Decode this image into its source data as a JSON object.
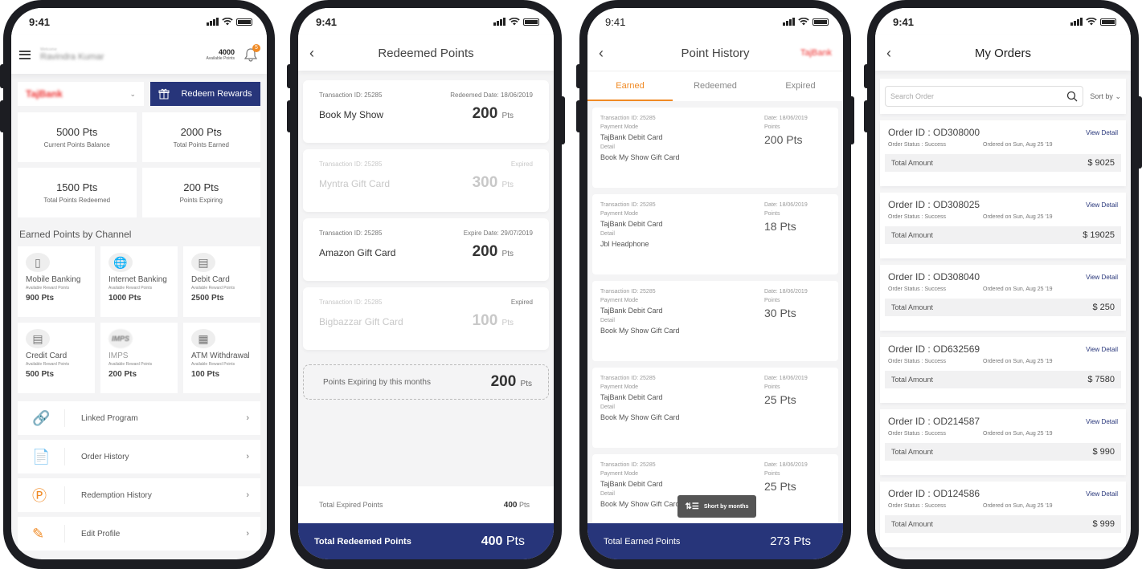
{
  "status_time": "9:41",
  "screen1": {
    "user_small": "Welcome",
    "user_name": "Ravindra Kumar",
    "available_points": "4000",
    "available_points_label": "Available Points",
    "notification_count": "5",
    "bank_name": "TajBank",
    "redeem_button": "Redeem Rewards",
    "stats": [
      {
        "value": "5000 Pts",
        "label": "Current Points Balance"
      },
      {
        "value": "2000 Pts",
        "label": "Total Points Earned"
      },
      {
        "value": "1500 Pts",
        "label": "Total Points Redeemed"
      },
      {
        "value": "200 Pts",
        "label": "Points Expiring"
      }
    ],
    "channels_title": "Earned Points by Channel",
    "channels": [
      {
        "name": "Mobile Banking",
        "sub": "Available Reward Points",
        "points": "900 Pts"
      },
      {
        "name": "Internet Banking",
        "sub": "Available Reward Points",
        "points": "1000 Pts"
      },
      {
        "name": "Debit Card",
        "sub": "Available Reward Points",
        "points": "2500 Pts"
      },
      {
        "name": "Credit Card",
        "sub": "Available Reward Points",
        "points": "500 Pts"
      },
      {
        "name": "IMPS",
        "sub": "Available Reward Points",
        "points": "200 Pts"
      },
      {
        "name": "ATM Withdrawal",
        "sub": "Available Reward Points",
        "points": "100 Pts"
      }
    ],
    "menu": [
      {
        "label": "Linked Program"
      },
      {
        "label": "Order History"
      },
      {
        "label": "Redemption History"
      },
      {
        "label": "Edit Profile"
      }
    ]
  },
  "screen2": {
    "title": "Redeemed Points",
    "cards": [
      {
        "txn": "Transaction ID: 25285",
        "status": "Redeemed Date: 18/06/2019",
        "name": "Book My Show",
        "points": "200",
        "unit": "Pts"
      },
      {
        "txn": "Transaction ID: 25285",
        "status": "Expired",
        "name": "Myntra Gift Card",
        "points": "300",
        "unit": "Pts"
      },
      {
        "txn": "Transaction ID: 25285",
        "status": "Expire Date: 29/07/2019",
        "name": "Amazon Gift Card",
        "points": "200",
        "unit": "Pts"
      },
      {
        "txn": "Transaction ID: 25285",
        "status": "Expired",
        "name": "Bigbazzar Gift Card",
        "points": "100",
        "unit": "Pts"
      }
    ],
    "expiring_label": "Points Expiring by this months",
    "expiring_value": "200",
    "expiring_unit": "Pts",
    "total_expired_label": "Total Expired Points",
    "total_expired_value": "400",
    "total_expired_unit": "Pts",
    "total_redeemed_label": "Total Redeemed Points",
    "total_redeemed_value": "400",
    "total_redeemed_unit": "Pts"
  },
  "screen3": {
    "title": "Point History",
    "bank_name": "TajBank",
    "tabs": [
      "Earned",
      "Redeemed",
      "Expired"
    ],
    "active_tab": "Earned",
    "labels": {
      "payment_mode": "Payment Mode",
      "detail": "Detail",
      "points": "Points"
    },
    "cards": [
      {
        "txn": "Transaction ID: 25285",
        "date": "Date: 18/06/2019",
        "mode": "TajBank Debit Card",
        "detail": "Book My Show Gift Card",
        "points": "200 Pts"
      },
      {
        "txn": "Transaction ID: 25285",
        "date": "Date: 18/06/2019",
        "mode": "TajBank Debit Card",
        "detail": "Jbl Headphone",
        "points": "18 Pts"
      },
      {
        "txn": "Transaction ID: 25285",
        "date": "Date: 18/06/2019",
        "mode": "TajBank Debit Card",
        "detail": "Book My Show Gift Card",
        "points": "30 Pts"
      },
      {
        "txn": "Transaction ID: 25285",
        "date": "Date: 18/06/2019",
        "mode": "TajBank Debit Card",
        "detail": "Book My Show Gift Card",
        "points": "25 Pts"
      },
      {
        "txn": "Transaction ID: 25285",
        "date": "Date: 18/06/2019",
        "mode": "TajBank Debit Card",
        "detail": "Book My Show Gift Card",
        "points": "25 Pts"
      }
    ],
    "sort_chip": "Short by months",
    "total_label": "Total Earned Points",
    "total_value": "273 Pts"
  },
  "screen4": {
    "title": "My Orders",
    "search_placeholder": "Search Order",
    "sort_by": "Sort by",
    "view_detail": "View Detail",
    "total_amount_label": "Total Amount",
    "orders": [
      {
        "id": "Order ID : OD308000",
        "status": "Order Status : Success",
        "date": "Ordered on Sun, Aug 25 '19",
        "amount": "$ 9025"
      },
      {
        "id": "Order ID : OD308025",
        "status": "Order Status : Success",
        "date": "Ordered on Sun, Aug 25 '19",
        "amount": "$ 19025"
      },
      {
        "id": "Order ID : OD308040",
        "status": "Order Status : Success",
        "date": "Ordered on Sun, Aug 25 '19",
        "amount": "$ 250"
      },
      {
        "id": "Order ID : OD632569",
        "status": "Order Status : Success",
        "date": "Ordered on Sun, Aug 25 '19",
        "amount": "$ 7580"
      },
      {
        "id": "Order ID : OD214587",
        "status": "Order Status : Success",
        "date": "Ordered on Sun, Aug 25 '19",
        "amount": "$ 990"
      },
      {
        "id": "Order ID : OD124586",
        "status": "Order Status : Success",
        "date": "Ordered on Sun, Aug 25 '19",
        "amount": "$ 999"
      }
    ]
  },
  "colors": {
    "primary": "#27357a",
    "accent": "#f08a24"
  }
}
